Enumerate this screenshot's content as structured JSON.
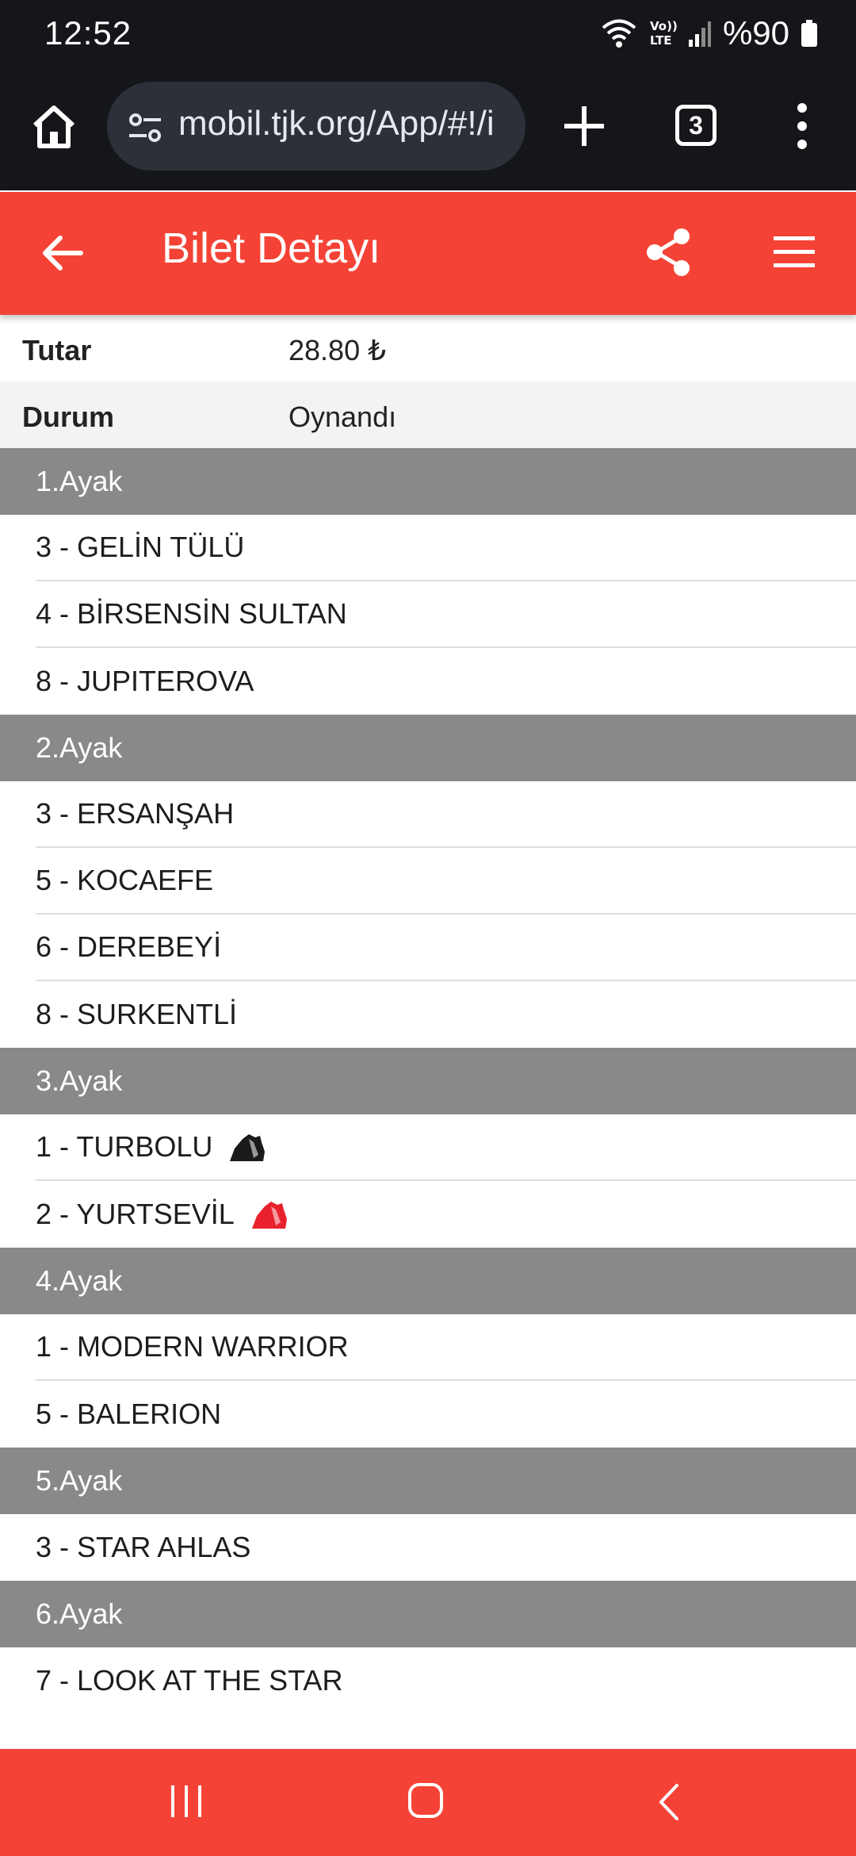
{
  "status_bar": {
    "time": "12:52",
    "battery": "%90"
  },
  "browser": {
    "url": "mobil.tjk.org/App/#!/i",
    "tabs_count": "3"
  },
  "header": {
    "title": "Bilet Detayı"
  },
  "info": {
    "amount_label": "Tutar",
    "amount_value": "28.80 ₺",
    "status_label": "Durum",
    "status_value": "Oynandı"
  },
  "legs": [
    {
      "title": "1.Ayak",
      "horses": [
        {
          "label": "3 - GELİN TÜLÜ"
        },
        {
          "label": "4 - BİRSENSİN SULTAN"
        },
        {
          "label": "8 - JUPITEROVA"
        }
      ]
    },
    {
      "title": "2.Ayak",
      "horses": [
        {
          "label": "3 - ERSANŞAH"
        },
        {
          "label": "5 - KOCAEFE"
        },
        {
          "label": "6 - DEREBEYİ"
        },
        {
          "label": "8 - SURKENTLİ"
        }
      ]
    },
    {
      "title": "3.Ayak",
      "horses": [
        {
          "label": "1 - TURBOLU",
          "silk_icon": "jockey-silk-icon",
          "silk_color": "#1a1a1a"
        },
        {
          "label": "2 - YURTSEVİL",
          "silk_icon": "jockey-silk-icon",
          "silk_color": "#e8212c"
        }
      ]
    },
    {
      "title": "4.Ayak",
      "horses": [
        {
          "label": "1 - MODERN WARRIOR"
        },
        {
          "label": "5 - BALERION"
        }
      ]
    },
    {
      "title": "5.Ayak",
      "horses": [
        {
          "label": "3 - STAR AHLAS"
        }
      ]
    },
    {
      "title": "6.Ayak",
      "horses": [
        {
          "label": "7 - LOOK AT THE STAR"
        }
      ]
    }
  ],
  "colors": {
    "accent": "#f44336",
    "leg_header": "#898989",
    "system_bar": "#15161a"
  }
}
